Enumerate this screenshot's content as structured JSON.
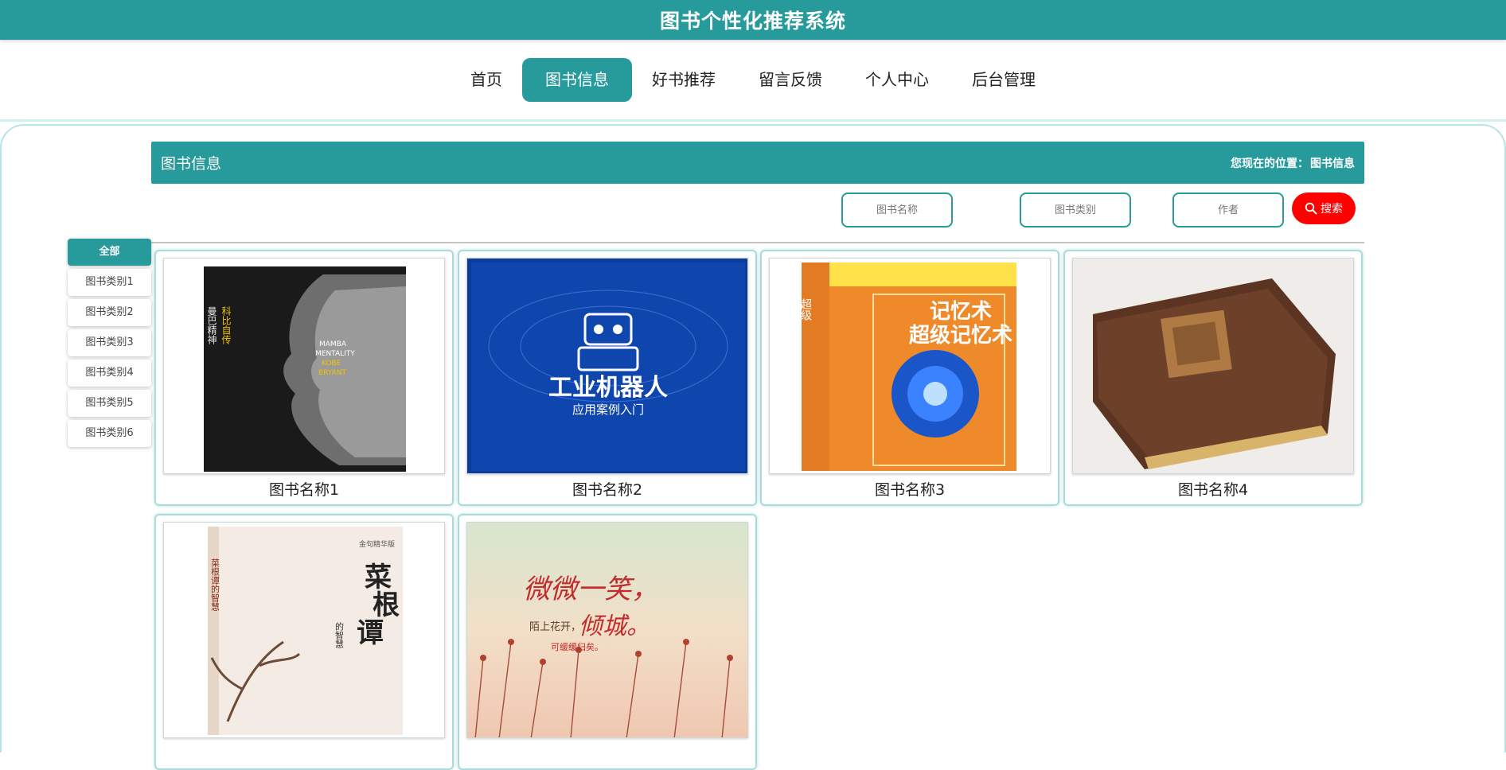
{
  "app": {
    "title": "图书个性化推荐系统"
  },
  "nav": {
    "items": [
      {
        "label": "首页"
      },
      {
        "label": "图书信息"
      },
      {
        "label": "好书推荐"
      },
      {
        "label": "留言反馈"
      },
      {
        "label": "个人中心"
      },
      {
        "label": "后台管理"
      }
    ],
    "active_index": 1
  },
  "section": {
    "title": "图书信息",
    "breadcrumb_prefix": "您现在的位置：",
    "breadcrumb_current": "图书信息"
  },
  "search": {
    "name_placeholder": "图书名称",
    "category_placeholder": "图书类别",
    "author_placeholder": "作者",
    "button_label": "搜索"
  },
  "categories": [
    {
      "label": "全部",
      "active": true
    },
    {
      "label": "图书类别1"
    },
    {
      "label": "图书类别2"
    },
    {
      "label": "图书类别3"
    },
    {
      "label": "图书类别4"
    },
    {
      "label": "图书类别5"
    },
    {
      "label": "图书类别6"
    }
  ],
  "books": [
    {
      "name": "图书名称1",
      "cover_texts": [
        "曼巴精神",
        "科比自传",
        "MAMBA",
        "MENTALITY",
        "KOBE",
        "BRYANT"
      ]
    },
    {
      "name": "图书名称2",
      "cover_texts": [
        "工业机器人",
        "应用案例入门"
      ]
    },
    {
      "name": "图书名称3",
      "cover_texts": [
        "超级",
        "记忆术",
        "超级记忆术"
      ]
    },
    {
      "name": "图书名称4",
      "cover_texts": []
    },
    {
      "name": "",
      "cover_texts": [
        "菜",
        "根",
        "谭",
        "的智慧",
        "金句精华版",
        "菜根谭的智慧"
      ]
    },
    {
      "name": "",
      "cover_texts": [
        "微微一笑，",
        "倾城。",
        "陌上花开，",
        "可缓缓归矣。"
      ]
    }
  ],
  "colors": {
    "primary": "#279a9b",
    "search_button": "#ff0000",
    "nav_line": "#d3eeee"
  },
  "icons": {
    "search_button_icon": "search-icon"
  }
}
